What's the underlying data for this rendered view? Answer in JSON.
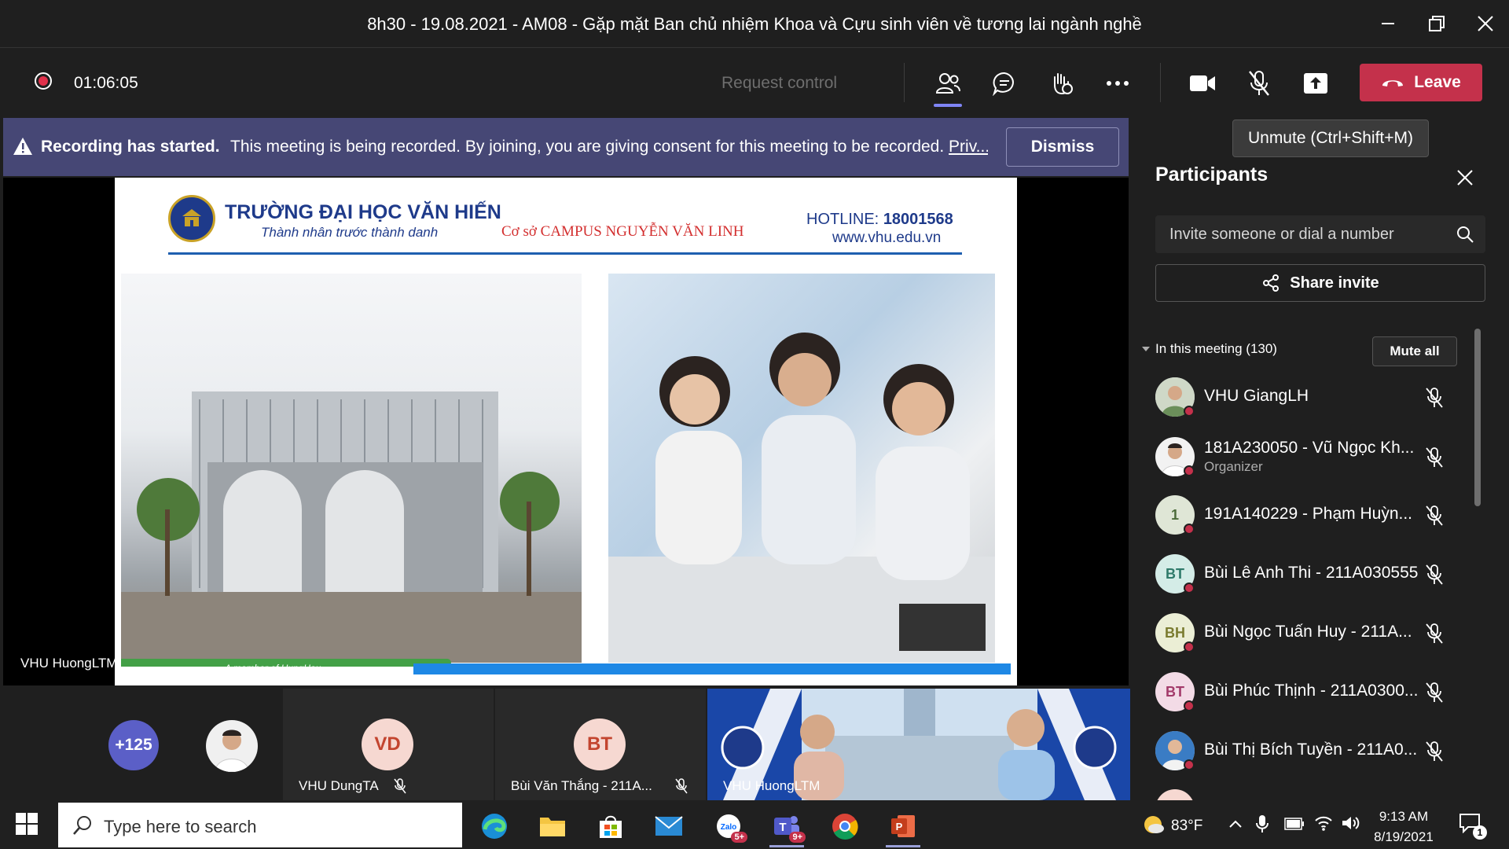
{
  "window": {
    "title": "8h30 - 19.08.2021 - AM08 - Gặp mặt Ban chủ nhiệm Khoa và Cựu sinh viên về tương lai ngành nghề"
  },
  "toolbar": {
    "timer": "01:06:05",
    "request_control": "Request control",
    "leave_label": "Leave",
    "mic_tooltip": "Unmute (Ctrl+Shift+M)"
  },
  "banner": {
    "bold": "Recording has started.",
    "text": "This meeting is being recorded. By joining, you are giving consent for this meeting to be recorded.",
    "link": "Priv...",
    "dismiss": "Dismiss"
  },
  "slide": {
    "university": "TRƯỜNG ĐẠI HỌC VĂN HIẾN",
    "motto": "Thành nhân trước thành danh",
    "campus": "Cơ sở CAMPUS NGUYỄN VĂN LINH",
    "hotline_label": "HOTLINE:",
    "hotline_number": "18001568",
    "website": "www.vhu.edu.vn",
    "member_text": "A member of HungHau"
  },
  "presenter_name": "VHU HuongLTM",
  "gallery": {
    "overflow_count": "+125",
    "tiles": [
      {
        "initials": "VD",
        "name": "VHU DungTA"
      },
      {
        "initials": "BT",
        "name": "Bùi Văn Thắng - 211A..."
      },
      {
        "name": "VHU HuongLTM"
      }
    ]
  },
  "participants": {
    "title": "Participants",
    "invite_placeholder": "Invite someone or dial a number",
    "share_invite": "Share invite",
    "section_label": "In this meeting (130)",
    "mute_all": "Mute all",
    "list": [
      {
        "initials": "",
        "name": "VHU GiangLH",
        "role": ""
      },
      {
        "initials": "",
        "name": "181A230050 - Vũ Ngọc Kh...",
        "role": "Organizer"
      },
      {
        "initials": "1",
        "name": "191A140229 - Phạm Huỳn...",
        "role": ""
      },
      {
        "initials": "BT",
        "name": "Bùi Lê Anh Thi - 211A030555",
        "role": ""
      },
      {
        "initials": "BH",
        "name": "Bùi Ngọc Tuấn Huy - 211A...",
        "role": ""
      },
      {
        "initials": "BT",
        "name": "Bùi Phúc Thịnh - 211A0300...",
        "role": ""
      },
      {
        "initials": "",
        "name": "Bùi Thị Bích Tuyền - 211A0...",
        "role": ""
      }
    ]
  },
  "taskbar": {
    "search_placeholder": "Type here to search",
    "zalo_badge": "5+",
    "teams_badge": "9+",
    "weather": "83°F",
    "time": "9:13 AM",
    "date": "8/19/2021",
    "notification_count": "1"
  },
  "colors": {
    "leave_red": "#c4314b",
    "banner_purple": "#464775",
    "accent": "#7f85f5"
  }
}
